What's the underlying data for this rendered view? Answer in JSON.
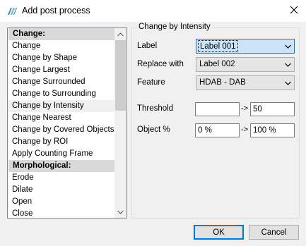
{
  "window": {
    "title": "Add post process"
  },
  "icons": {
    "app": "app-logo-icon",
    "close": "close-icon",
    "scroll_up": "chevron-up-icon",
    "scroll_down": "chevron-down-icon",
    "dropdown": "chevron-down-icon"
  },
  "list": {
    "items": [
      {
        "label": "Change:",
        "type": "header"
      },
      {
        "label": "Change",
        "type": "item"
      },
      {
        "label": "Change by Shape",
        "type": "item"
      },
      {
        "label": "Change Largest",
        "type": "item"
      },
      {
        "label": "Change Surrounded",
        "type": "item"
      },
      {
        "label": "Change to Surrounding",
        "type": "item"
      },
      {
        "label": "Change by Intensity",
        "type": "item"
      },
      {
        "label": "Change Nearest",
        "type": "item"
      },
      {
        "label": "Change by Covered Objects",
        "type": "item"
      },
      {
        "label": "Change by ROI",
        "type": "item"
      },
      {
        "label": "Apply Counting Frame",
        "type": "item"
      },
      {
        "label": "Morphological:",
        "type": "header"
      },
      {
        "label": "Erode",
        "type": "item"
      },
      {
        "label": "Dilate",
        "type": "item"
      },
      {
        "label": "Open",
        "type": "item"
      },
      {
        "label": "Close",
        "type": "item"
      }
    ]
  },
  "group": {
    "title": "Change by Intensity",
    "label_label": "Label",
    "label_value": "Label 001",
    "replace_label": "Replace with",
    "replace_value": "Label 002",
    "feature_label": "Feature",
    "feature_value": "HDAB - DAB",
    "threshold_label": "Threshold",
    "threshold_min": "",
    "threshold_max": "50",
    "object_label": "Object %",
    "object_min": "0 %",
    "object_max": "100 %",
    "range_sep": "->"
  },
  "buttons": {
    "ok": "OK",
    "cancel": "Cancel"
  }
}
